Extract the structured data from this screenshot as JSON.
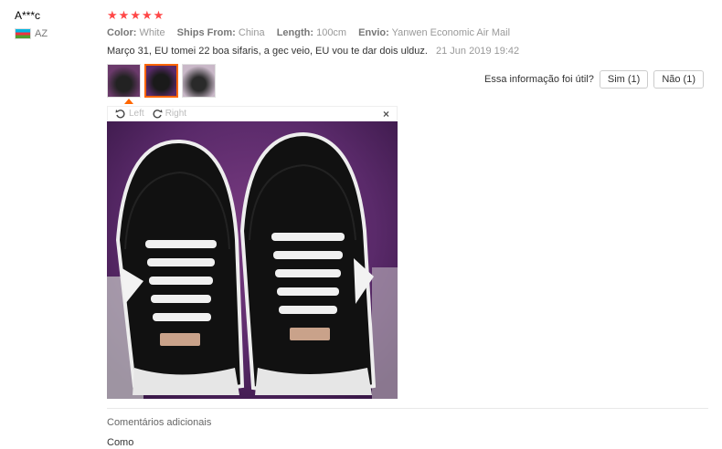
{
  "reviewer": {
    "name": "A***c",
    "country_code": "AZ"
  },
  "rating": {
    "stars": 5,
    "star_glyph": "★",
    "color": "#ff4747"
  },
  "attributes": [
    {
      "key": "Color:",
      "value": "White"
    },
    {
      "key": "Ships From:",
      "value": "China"
    },
    {
      "key": "Length:",
      "value": "100cm"
    },
    {
      "key": "Envio:",
      "value": "Yanwen Economic Air Mail"
    }
  ],
  "comment": {
    "text": "Março 31, EU tomei 22 boa sifaris, a gec veio, EU vou te dar dois ulduz.",
    "date": "21 Jun 2019 19:42"
  },
  "helpful": {
    "question": "Essa informação foi útil?",
    "yes": "Sim (1)",
    "no": "Não (1)"
  },
  "viewer": {
    "rotate_left": "Left",
    "rotate_right": "Right",
    "close": "×"
  },
  "additional": {
    "title": "Comentários adicionais",
    "text": "Como"
  },
  "colors": {
    "accent": "#ff6600",
    "purple_rug": "#5a2a6a"
  }
}
